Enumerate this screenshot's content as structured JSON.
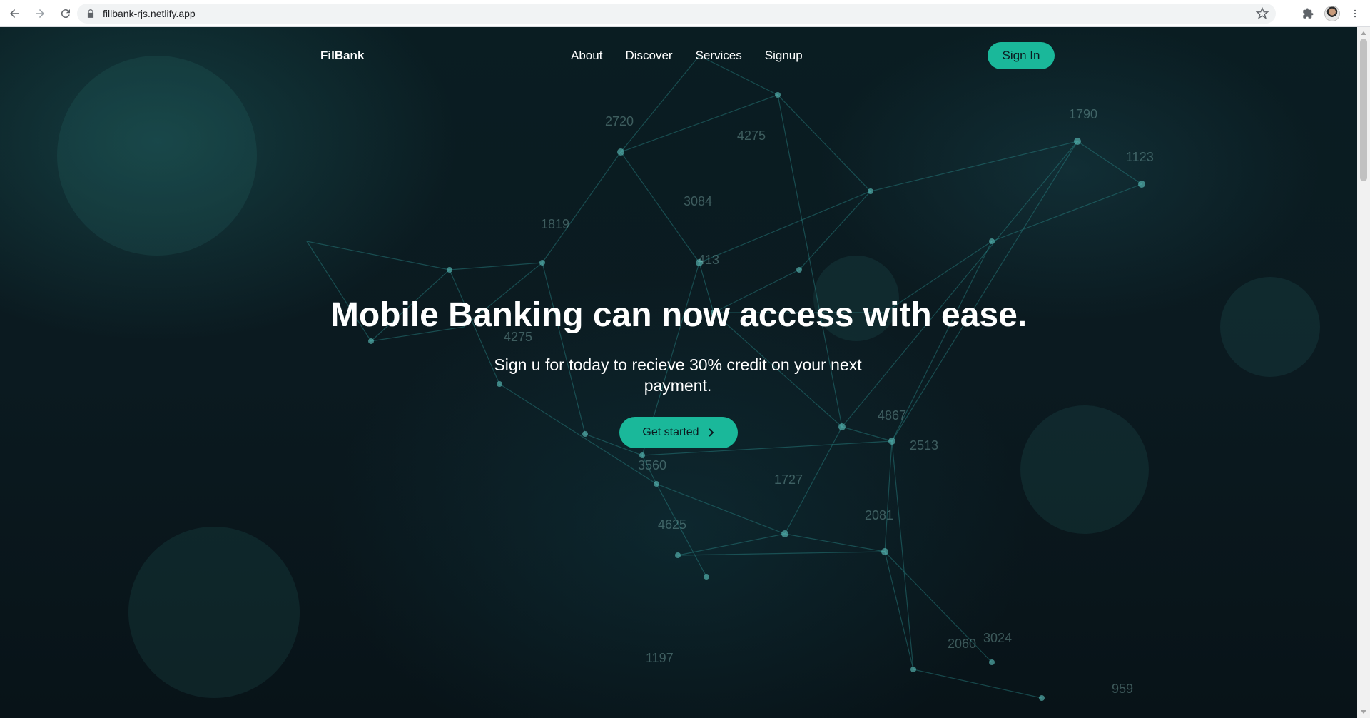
{
  "browser": {
    "url": "fillbank-rjs.netlify.app",
    "icons": [
      "back-arrow-icon",
      "forward-arrow-icon",
      "reload-icon",
      "lock-icon",
      "star-icon",
      "extensions-icon",
      "profile-avatar",
      "menu-dots-icon"
    ]
  },
  "navbar": {
    "brand": "FilBank",
    "links": [
      "About",
      "Discover",
      "Services",
      "Signup"
    ],
    "signin_label": "Sign In"
  },
  "hero": {
    "title": "Mobile Banking can now access with ease.",
    "subtitle": "Sign u for today to recieve 30% credit on your next payment.",
    "cta_label": "Get started",
    "cta_icon": "chevron-right-icon"
  },
  "background_numbers": [
    "2720",
    "4275",
    "1790",
    "1123",
    "3084",
    "1819",
    "413",
    "4275",
    "4867",
    "2513",
    "1727",
    "2081",
    "4625",
    "3560",
    "2060",
    "3024",
    "959",
    "1197"
  ],
  "colors": {
    "accent": "#1ab89a",
    "background": "#0b1a1f",
    "network_line": "#2a8a8a"
  }
}
